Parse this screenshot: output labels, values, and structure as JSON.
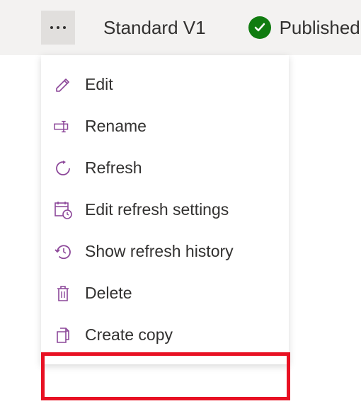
{
  "header": {
    "title": "Standard V1",
    "status": {
      "label": "Published",
      "color": "#107c10"
    }
  },
  "menu": {
    "items": [
      {
        "label": "Edit",
        "icon": "pencil-icon"
      },
      {
        "label": "Rename",
        "icon": "rename-icon"
      },
      {
        "label": "Refresh",
        "icon": "refresh-icon"
      },
      {
        "label": "Edit refresh settings",
        "icon": "calendar-clock-icon"
      },
      {
        "label": "Show refresh history",
        "icon": "history-icon"
      },
      {
        "label": "Delete",
        "icon": "trash-icon"
      },
      {
        "label": "Create copy",
        "icon": "copy-icon"
      }
    ]
  },
  "highlight": {
    "target_index": 6
  },
  "iconColor": "#8c4799"
}
